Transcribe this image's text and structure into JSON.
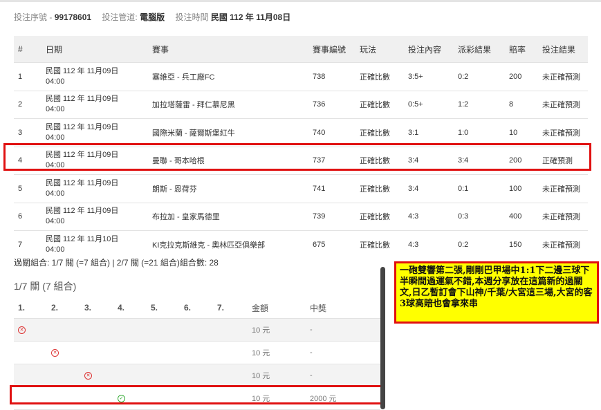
{
  "meta": {
    "serial_label": "投注序號 -",
    "serial_value": "99178601",
    "channel_label": "投注管道:",
    "channel_value": "電腦版",
    "time_label": "投注時間",
    "time_value": "民國 112 年 11月08日"
  },
  "table": {
    "headers": [
      "#",
      "日期",
      "賽事",
      "賽事編號",
      "玩法",
      "投注內容",
      "派彩結果",
      "賠率",
      "投注結果"
    ],
    "rows": [
      {
        "n": "1",
        "d1": "民國 112 年 11月09日",
        "d2": "04:00",
        "match": "塞維亞 - 兵工廠FC",
        "id": "738",
        "play": "正確比數",
        "content": "3:5+",
        "result": "0:2",
        "odds": "200",
        "outcome": "未正確預測"
      },
      {
        "n": "2",
        "d1": "民國 112 年 11月09日",
        "d2": "04:00",
        "match": "加拉塔薩雷 - 拜仁慕尼黑",
        "id": "736",
        "play": "正確比數",
        "content": "0:5+",
        "result": "1:2",
        "odds": "8",
        "outcome": "未正確預測"
      },
      {
        "n": "3",
        "d1": "民國 112 年 11月09日",
        "d2": "04:00",
        "match": "國際米蘭 - 薩爾斯堡紅牛",
        "id": "740",
        "play": "正確比數",
        "content": "3:1",
        "result": "1:0",
        "odds": "10",
        "outcome": "未正確預測"
      },
      {
        "n": "4",
        "d1": "民國 112 年 11月09日",
        "d2": "04:00",
        "match": "曼聯 - 哥本哈根",
        "id": "737",
        "play": "正確比數",
        "content": "3:4",
        "result": "3:4",
        "odds": "200",
        "outcome": "正確預測"
      },
      {
        "n": "5",
        "d1": "民國 112 年 11月09日",
        "d2": "04:00",
        "match": "朗斯 - 恩荷芬",
        "id": "741",
        "play": "正確比數",
        "content": "3:4",
        "result": "0:1",
        "odds": "100",
        "outcome": "未正確預測"
      },
      {
        "n": "6",
        "d1": "民國 112 年 11月09日",
        "d2": "04:00",
        "match": "布拉加 - 皇家馬德里",
        "id": "739",
        "play": "正確比數",
        "content": "4:3",
        "result": "0:3",
        "odds": "400",
        "outcome": "未正確預測"
      },
      {
        "n": "7",
        "d1": "民國 112 年 11月10日",
        "d2": "04:00",
        "match": "KI克拉克斯維克 - 奧林匹亞俱樂部",
        "id": "675",
        "play": "正確比數",
        "content": "4:3",
        "result": "0:2",
        "odds": "150",
        "outcome": "未正確預測"
      }
    ]
  },
  "summary": "過關組合: 1/7 關 (=7 組合) | 2/7 關 (=21 組合)組合數: 28",
  "combo": {
    "title": "1/7 關 (7 組合)",
    "headers": [
      "1.",
      "2.",
      "3.",
      "4.",
      "5.",
      "6.",
      "7.",
      "金額",
      "中獎"
    ],
    "rows": [
      {
        "amount": "10 元",
        "win": "-"
      },
      {
        "amount": "10 元",
        "win": "-"
      },
      {
        "amount": "10 元",
        "win": "-"
      },
      {
        "amount": "10 元",
        "win": "2000 元"
      }
    ]
  },
  "icons": {
    "miss": "x-circle-icon",
    "hit": "check-circle-icon"
  },
  "colors": {
    "highlight_border": "#e01010",
    "note_bg": "#ffff00",
    "miss": "#dd3333",
    "hit": "#33aa33"
  },
  "note": "一砲雙響第二張,剛剛巴甲場中1:1下二邊三球下半瞬間過運氣不錯,本週分享放在這篇新的過關文,日乙暫訂會下山神/千葉/大宮這三場,大宮的客3球高賠也會拿來串"
}
